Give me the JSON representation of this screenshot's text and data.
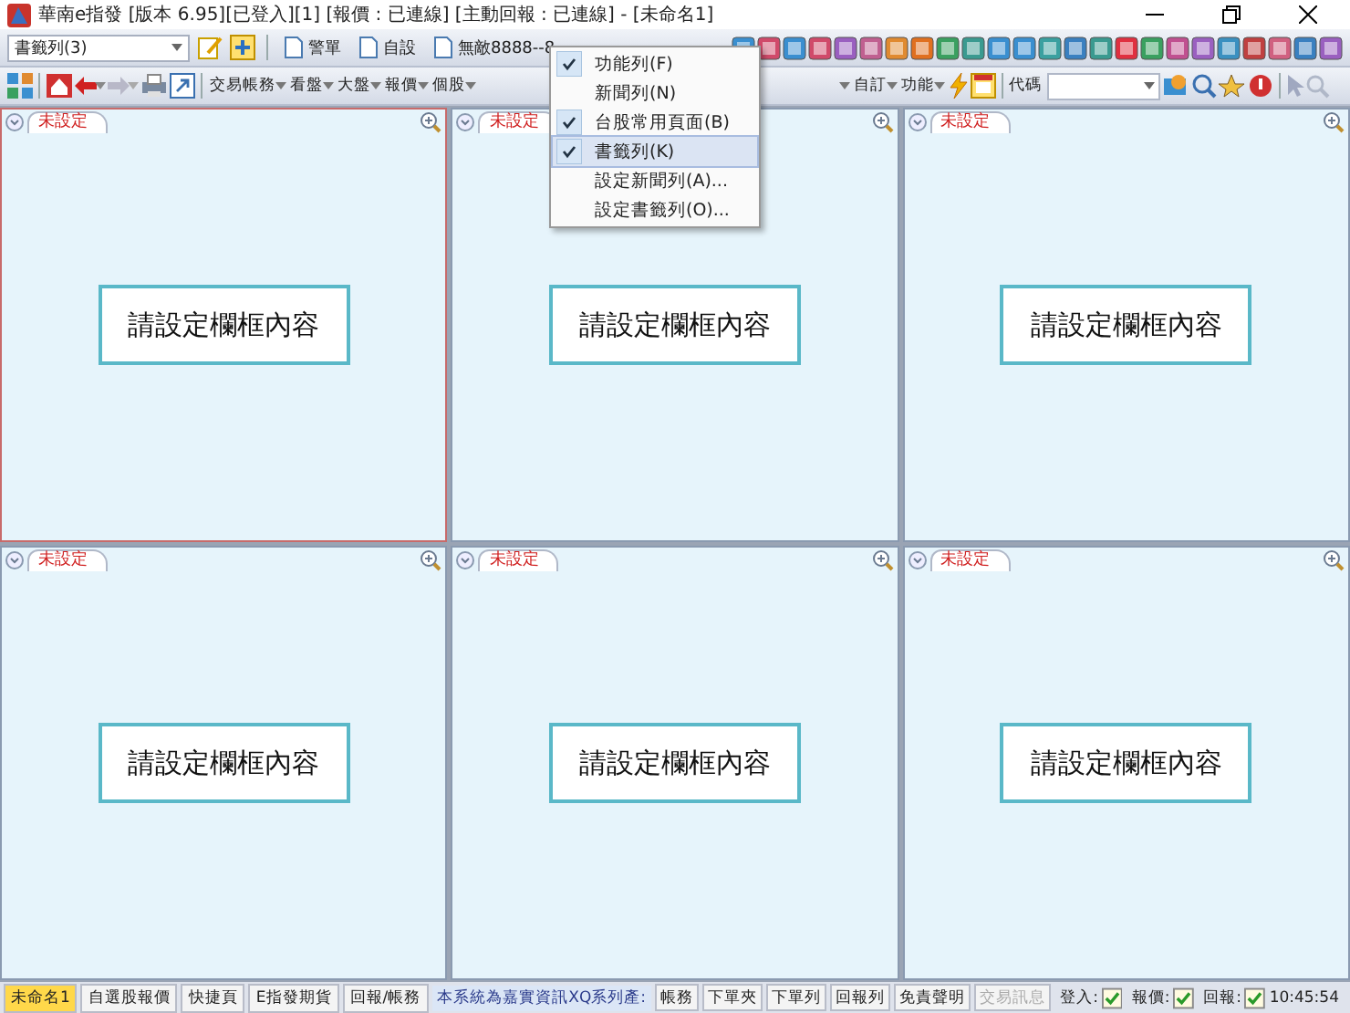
{
  "window": {
    "title": "華南e指發 [版本 6.95][已登入][1] [報價 : 已連線] [主動回報 : 已連線] - [未命名1]"
  },
  "toolbar1": {
    "dropdown": "書籤列(3)",
    "bookmarks": [
      "警單",
      "自設",
      "無敵8888--8"
    ]
  },
  "toolbar2": {
    "menus_left": [
      "交易帳務",
      "看盤",
      "大盤",
      "報價",
      "個股"
    ],
    "menus_right": [
      "自訂",
      "功能"
    ],
    "code_label": "代碼"
  },
  "context_menu": [
    {
      "label": "功能列(F)",
      "checked": true,
      "selected": false
    },
    {
      "label": "新聞列(N)",
      "checked": false,
      "selected": false
    },
    {
      "label": "台股常用頁面(B)",
      "checked": true,
      "selected": false
    },
    {
      "label": "書籤列(K)",
      "checked": true,
      "selected": true
    },
    {
      "label": "設定新聞列(A)...",
      "checked": false,
      "selected": false
    },
    {
      "label": "設定書籤列(O)...",
      "checked": false,
      "selected": false
    }
  ],
  "panels": [
    {
      "tab": "未設定",
      "button": "請設定欄框內容",
      "selected": true
    },
    {
      "tab": "未設定",
      "button": "請設定欄框內容",
      "selected": false
    },
    {
      "tab": "未設定",
      "button": "請設定欄框內容",
      "selected": false
    },
    {
      "tab": "未設定",
      "button": "請設定欄框內容",
      "selected": false
    },
    {
      "tab": "未設定",
      "button": "請設定欄框內容",
      "selected": false
    },
    {
      "tab": "未設定",
      "button": "請設定欄框內容",
      "selected": false
    }
  ],
  "status_tabs": [
    {
      "label": "未命名1",
      "selected": true
    },
    {
      "label": "自選股報價",
      "selected": false
    },
    {
      "label": "快捷頁",
      "selected": false
    },
    {
      "label": "E指發期貨",
      "selected": false
    },
    {
      "label": "回報/帳務",
      "selected": false
    }
  ],
  "marquee": "本系統為嘉實資訊XQ系列產:",
  "status_buttons": [
    {
      "label": "帳務",
      "disabled": false
    },
    {
      "label": "下單夾",
      "disabled": false
    },
    {
      "label": "下單列",
      "disabled": false
    },
    {
      "label": "回報列",
      "disabled": false
    },
    {
      "label": "免責聲明",
      "disabled": false
    },
    {
      "label": "交易訊息",
      "disabled": true
    }
  ],
  "indicators": [
    {
      "label": "登入:",
      "on": true
    },
    {
      "label": "報價:",
      "on": true
    },
    {
      "label": "回報:",
      "on": true
    }
  ],
  "clock": "10:45:54"
}
